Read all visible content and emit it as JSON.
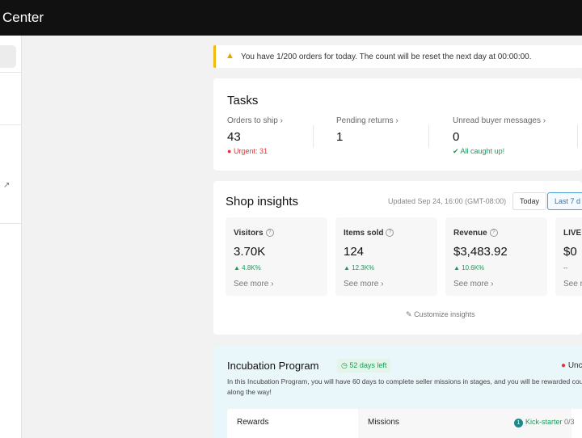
{
  "header": {
    "title": "Center"
  },
  "notice": {
    "text": "You have 1/200 orders for today. The count will be reset the next day at 00:00:00."
  },
  "tasks": {
    "title": "Tasks",
    "items": [
      {
        "label": "Orders to ship ›",
        "value": "43",
        "sub": "Urgent: 31"
      },
      {
        "label": "Pending returns ›",
        "value": "1",
        "sub": ""
      },
      {
        "label": "Unread buyer messages ›",
        "value": "0",
        "sub": "All caught up!"
      }
    ]
  },
  "insights": {
    "title": "Shop insights",
    "updated": "Updated Sep 24, 16:00 (GMT-08:00)",
    "today_label": "Today",
    "last7_label": "Last 7 d",
    "metrics": [
      {
        "label": "Visitors",
        "value": "3.70K",
        "change": "▲ 4.8K%",
        "more": "See more ›"
      },
      {
        "label": "Items sold",
        "value": "124",
        "change": "▲ 12.3K%",
        "more": "See more ›"
      },
      {
        "label": "Revenue",
        "value": "$3,483.92",
        "change": "▲ 10.6K%",
        "more": "See more ›"
      },
      {
        "label": "LIVE",
        "value": "$0",
        "change": "--",
        "more": "See r"
      }
    ],
    "customize": "Customize insights"
  },
  "incubation": {
    "title": "Incubation Program",
    "days_left": "52 days left",
    "status": "Unc",
    "description": "In this Incubation Program, you will have 60 days to complete seller missions in stages, and you will be rewarded coupons along the way!",
    "tabs": {
      "rewards": "Rewards",
      "missions": "Missions"
    },
    "kickstarter": {
      "num": "1",
      "label": "Kick-starter",
      "progress": "0/3"
    }
  },
  "colors": {
    "accent": "#1e78b8",
    "success": "#1a9b5b",
    "danger": "#d83a3a",
    "warning": "#f0b90b"
  }
}
